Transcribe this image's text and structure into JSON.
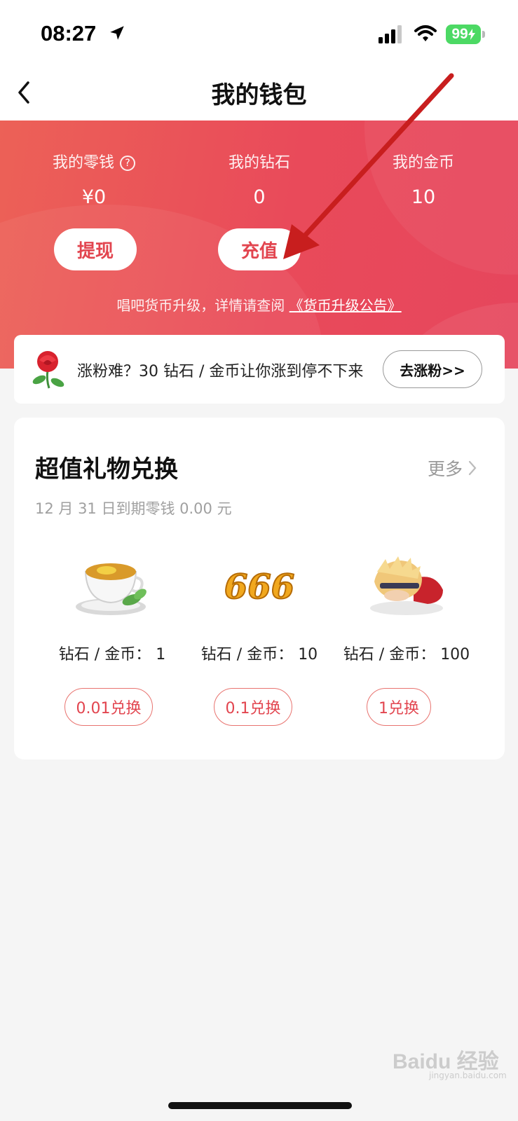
{
  "status_bar": {
    "time": "08:27",
    "battery": "99"
  },
  "nav": {
    "title": "我的钱包"
  },
  "wallet": {
    "change": {
      "label": "我的零钱",
      "value": "¥0"
    },
    "diamonds": {
      "label": "我的钻石",
      "value": "0"
    },
    "coins": {
      "label": "我的金币",
      "value": "10"
    },
    "withdraw_label": "提现",
    "recharge_label": "充值",
    "notice_text": "唱吧货币升级，详情请查阅",
    "notice_link": "《货币升级公告》"
  },
  "promo": {
    "text": "涨粉难？30 钻石 / 金币让你涨到停不下来",
    "button": "去涨粉>>"
  },
  "gift_exchange": {
    "title": "超值礼物兑换",
    "more": "更多",
    "subtitle": "12 月 31 日到期零钱 0.00 元",
    "items": [
      {
        "icon": "tea-cup-icon",
        "price": "钻石 / 金币： 1",
        "button": "0.01兑换"
      },
      {
        "icon": "666-gift-icon",
        "price": "钻石 / 金币： 10",
        "button": "0.1兑换"
      },
      {
        "icon": "kneeling-figure-icon",
        "price": "钻石 / 金币： 100",
        "button": "1兑换"
      }
    ]
  },
  "watermark": {
    "brand": "Baidu 经验",
    "url": "jingyan.baidu.com"
  },
  "colors": {
    "accent": "#e2454f",
    "hero_start": "#ec6157",
    "hero_end": "#e6465d",
    "battery": "#4cd964"
  }
}
